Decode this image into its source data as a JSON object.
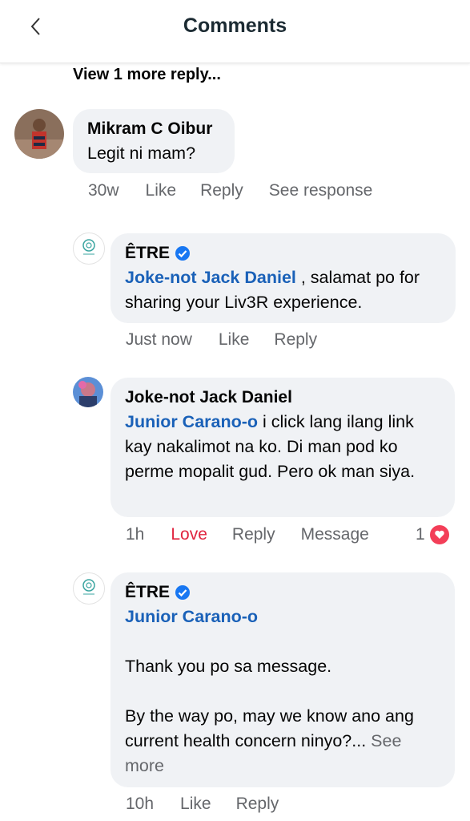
{
  "header": {
    "title": "Comments"
  },
  "view_more": "View 1 more reply...",
  "comments": [
    {
      "author": "Mikram C Oibur",
      "text": "Legit ni mam?",
      "time": "30w",
      "like": "Like",
      "reply": "Reply",
      "extra": "See response"
    },
    {
      "author": "ÊTRE",
      "mention": "Joke-not Jack Daniel",
      "text": " , salamat po for sharing your Liv3R experience.",
      "time": "Just now",
      "like": "Like",
      "reply": "Reply"
    },
    {
      "author": "Joke-not Jack Daniel",
      "mention": "Junior Carano-o",
      "text": " i click lang ilang link kay nakalimot na ko. Di man pod ko perme mopalit gud. Pero ok man siya.",
      "time": "1h",
      "like": "Love",
      "reply": "Reply",
      "extra": "Message",
      "reaction_count": "1"
    },
    {
      "author": "ÊTRE",
      "mention": "Junior Carano-o",
      "text_line1": "Thank you po sa message.",
      "text_line2": "By the way po, may we know ano ang current health concern ninyo?...",
      "see_more": " See more",
      "time": "10h",
      "like": "Like",
      "reply": "Reply"
    }
  ],
  "colors": {
    "mention": "#1a61b8",
    "love": "#e0243f",
    "verified": "#1877f2",
    "bubble": "#f0f2f5"
  },
  "icons": {
    "back": "chevron-left-icon",
    "verified": "verified-badge-icon",
    "reaction": "heart-icon"
  }
}
